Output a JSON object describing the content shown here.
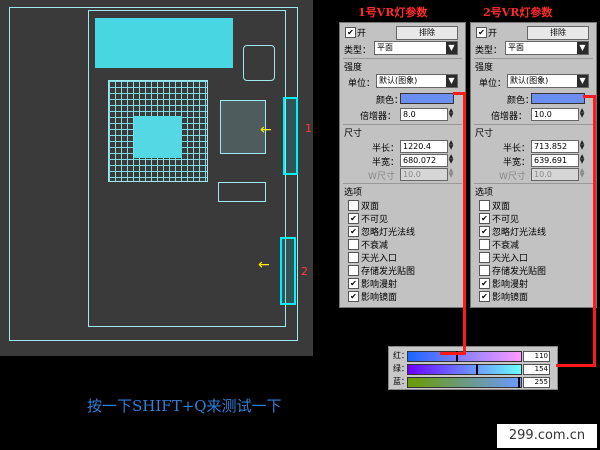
{
  "viewport": {
    "light1_label": "1",
    "light2_label": "2"
  },
  "hint": "按一下SHIFT+Q来测试一下",
  "footer": "299.com.cn",
  "panels": [
    {
      "title": "1号VR灯参数",
      "on_label": "开",
      "on_checked": true,
      "exclude_label": "排除",
      "type_label": "类型：",
      "type_value": "平面",
      "intensity_label": "强度",
      "units_label": "单位：",
      "units_value": "默认(图象)",
      "color_label": "颜色：",
      "color": "#6b8ff0",
      "multiplier_label": "倍增器：",
      "multiplier_value": "8.0",
      "size_label": "尺寸",
      "half_length_label": "半长：",
      "half_length_value": "1220.4",
      "half_width_label": "半宽：",
      "half_width_value": "680.072",
      "w_size_label": "W尺寸",
      "w_size_value": "10.0",
      "options_label": "选项",
      "options": [
        {
          "label": "双面",
          "checked": false
        },
        {
          "label": "不可见",
          "checked": true
        },
        {
          "label": "忽略灯光法线",
          "checked": true
        },
        {
          "label": "不衰减",
          "checked": false
        },
        {
          "label": "天光入口",
          "checked": false
        },
        {
          "label": "存储发光贴图",
          "checked": false
        },
        {
          "label": "影响漫射",
          "checked": true
        },
        {
          "label": "影响镜面",
          "checked": true
        }
      ]
    },
    {
      "title": "2号VR灯参数",
      "on_label": "开",
      "on_checked": true,
      "exclude_label": "排除",
      "type_label": "类型：",
      "type_value": "平面",
      "intensity_label": "强度",
      "units_label": "单位：",
      "units_value": "默认(图象)",
      "color_label": "颜色：",
      "color": "#6b8ff0",
      "multiplier_label": "倍增器：",
      "multiplier_value": "10.0",
      "size_label": "尺寸",
      "half_length_label": "半长：",
      "half_length_value": "713.852",
      "half_width_label": "半宽：",
      "half_width_value": "639.691",
      "w_size_label": "W尺寸",
      "w_size_value": "10.0",
      "options_label": "选项",
      "options": [
        {
          "label": "双面",
          "checked": false
        },
        {
          "label": "不可见",
          "checked": true
        },
        {
          "label": "忽略灯光法线",
          "checked": true
        },
        {
          "label": "不衰减",
          "checked": false
        },
        {
          "label": "天光入口",
          "checked": false
        },
        {
          "label": "存储发光贴图",
          "checked": false
        },
        {
          "label": "影响漫射",
          "checked": true
        },
        {
          "label": "影响镜面",
          "checked": true
        }
      ]
    }
  ],
  "picker": {
    "red_label": "红：",
    "red_value": "110",
    "green_label": "绿：",
    "green_value": "154",
    "blue_label": "蓝：",
    "blue_value": "255"
  },
  "colors": {
    "title_red": "#ff2a2a",
    "hint_blue": "#2e7fd8",
    "light_cyan": "#00f0ff",
    "swatch_blue": "#6b8ff0"
  }
}
